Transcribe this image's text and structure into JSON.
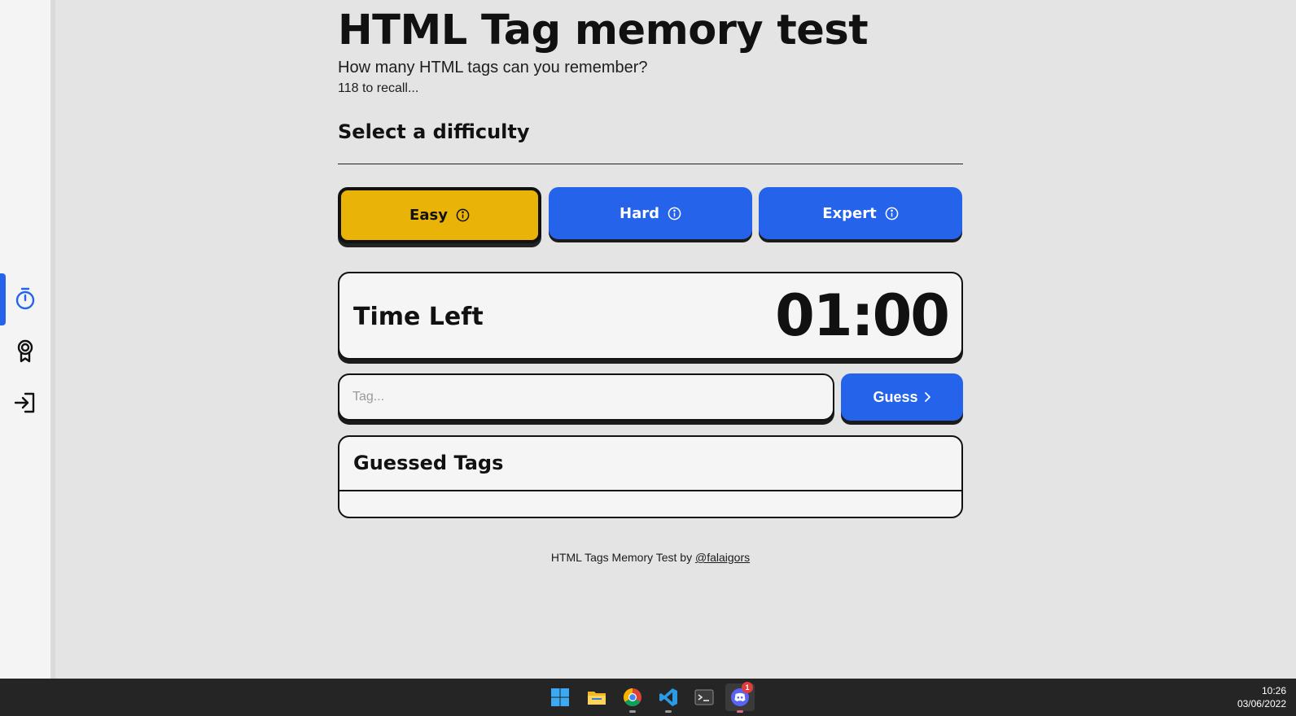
{
  "app": {
    "title": "HTML Tag memory test",
    "subtitle": "How many HTML tags can you remember?",
    "recall_count": "118 to recall..."
  },
  "sidebar": {
    "items": [
      {
        "name": "timer",
        "icon": "stopwatch-icon",
        "active": true
      },
      {
        "name": "achievements",
        "icon": "award-icon",
        "active": false
      },
      {
        "name": "login",
        "icon": "login-icon",
        "active": false
      }
    ]
  },
  "difficulty": {
    "heading": "Select a difficulty",
    "selected": "Easy",
    "options": [
      {
        "label": "Easy",
        "color": "#eab308"
      },
      {
        "label": "Hard",
        "color": "#2563eb"
      },
      {
        "label": "Expert",
        "color": "#2563eb"
      }
    ]
  },
  "timer": {
    "label": "Time Left",
    "value": "01:00"
  },
  "guess": {
    "placeholder": "Tag...",
    "value": "",
    "button_label": "Guess"
  },
  "guessed": {
    "title": "Guessed Tags",
    "items": []
  },
  "footer": {
    "text": "HTML Tags Memory Test by ",
    "author": "@falaigors"
  },
  "taskbar": {
    "apps": [
      "windows-start-icon",
      "file-explorer-icon",
      "chrome-icon",
      "vscode-icon",
      "terminal-icon",
      "discord-icon"
    ],
    "discord_badge": "1",
    "time": "10:26",
    "date": "03/06/2022"
  },
  "colors": {
    "accent": "#2563eb",
    "easy": "#eab308",
    "background": "#e4e4e4"
  }
}
